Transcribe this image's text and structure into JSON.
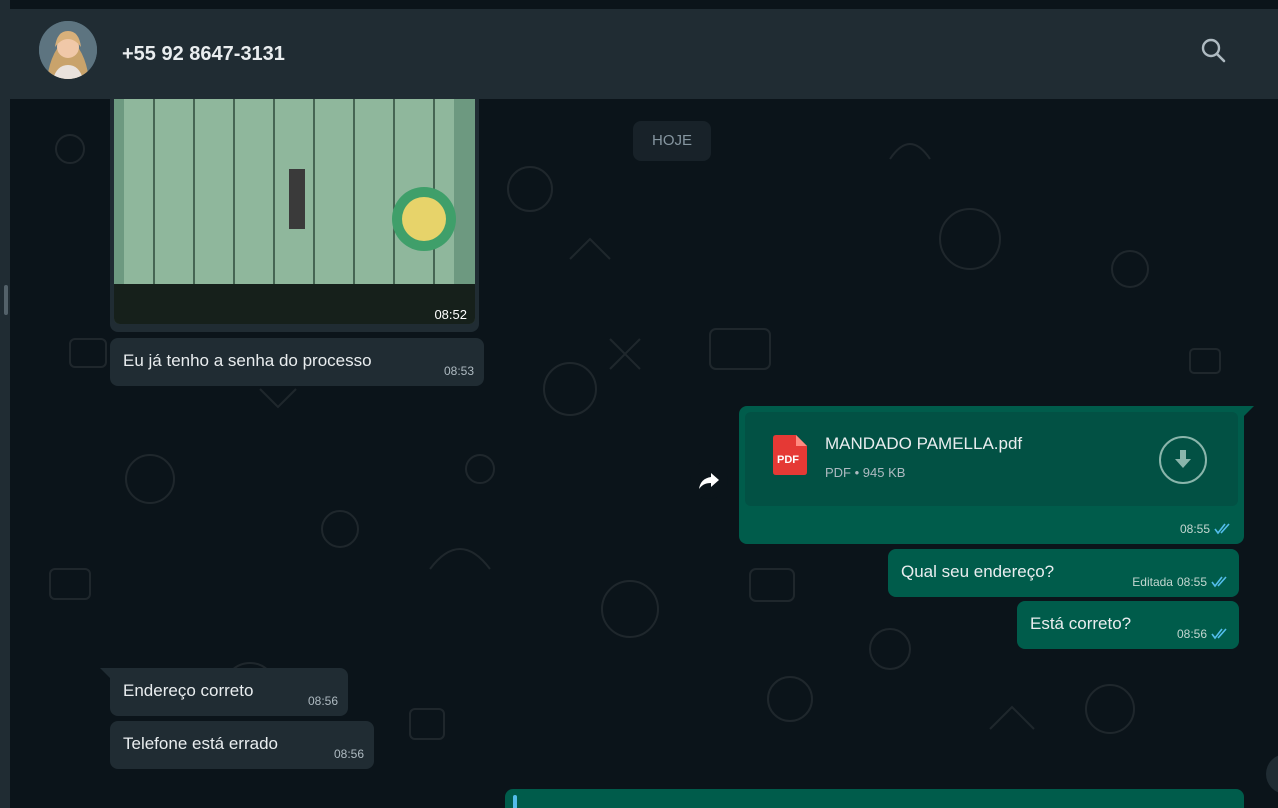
{
  "header": {
    "contact_name": "+55 92 8647-3131",
    "avatar": "avatar",
    "search_icon": "search-icon"
  },
  "date_chip": "HOJE",
  "messages": {
    "image_msg": {
      "time": "08:52"
    },
    "msg1": {
      "text": "Eu já tenho a senha do processo",
      "time": "08:53"
    },
    "document": {
      "name": "MANDADO PAMELLA.pdf",
      "info": "PDF • 945 KB",
      "icon_label": "PDF",
      "time": "08:55"
    },
    "msg2": {
      "text": "Qual seu endereço?",
      "edited": "Editada",
      "time": "08:55"
    },
    "msg3": {
      "text": "Está correto?",
      "time": "08:56"
    },
    "msg4": {
      "text": "Endereço correto",
      "time": "08:56"
    },
    "msg5": {
      "text": "Telefone está errado",
      "time": "08:56"
    }
  },
  "colors": {
    "background": "#0b141a",
    "header": "#202c33",
    "incoming_bubble": "#202c33",
    "outgoing_bubble": "#005c4b",
    "read_check": "#53bdeb",
    "pdf_red": "#e53935"
  }
}
